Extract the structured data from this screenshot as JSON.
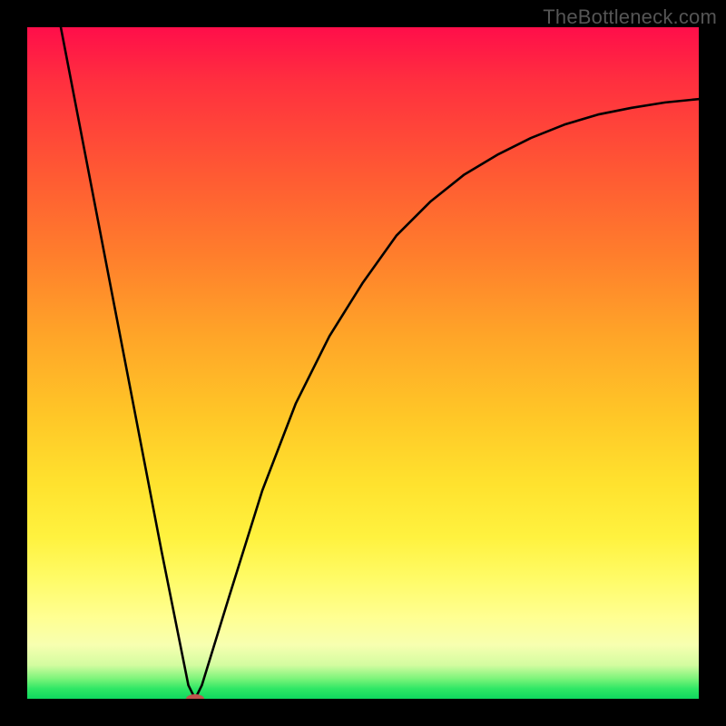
{
  "watermark": "TheBottleneck.com",
  "chart_data": {
    "type": "line",
    "title": "",
    "xlabel": "",
    "ylabel": "",
    "xlim": [
      0,
      100
    ],
    "ylim": [
      0,
      100
    ],
    "grid": false,
    "legend": false,
    "background_gradient": [
      "#ff0e4a",
      "#ff7e2c",
      "#ffe22e",
      "#ffff93",
      "#0fd85f"
    ],
    "series": [
      {
        "name": "bottleneck-curve",
        "color": "#000000",
        "x": [
          5,
          10,
          15,
          20,
          24,
          25,
          26,
          30,
          35,
          40,
          45,
          50,
          55,
          60,
          65,
          70,
          75,
          80,
          85,
          90,
          95,
          100
        ],
        "y": [
          100,
          74,
          48,
          22,
          2,
          0,
          2,
          15,
          31,
          44,
          54,
          62,
          69,
          74,
          78,
          81,
          83.5,
          85.5,
          87,
          88,
          88.8,
          89.3
        ]
      }
    ],
    "marker": {
      "name": "optimal-point",
      "x": 25,
      "y": 0,
      "color": "#c0544e",
      "rx": 10,
      "ry": 5
    }
  }
}
